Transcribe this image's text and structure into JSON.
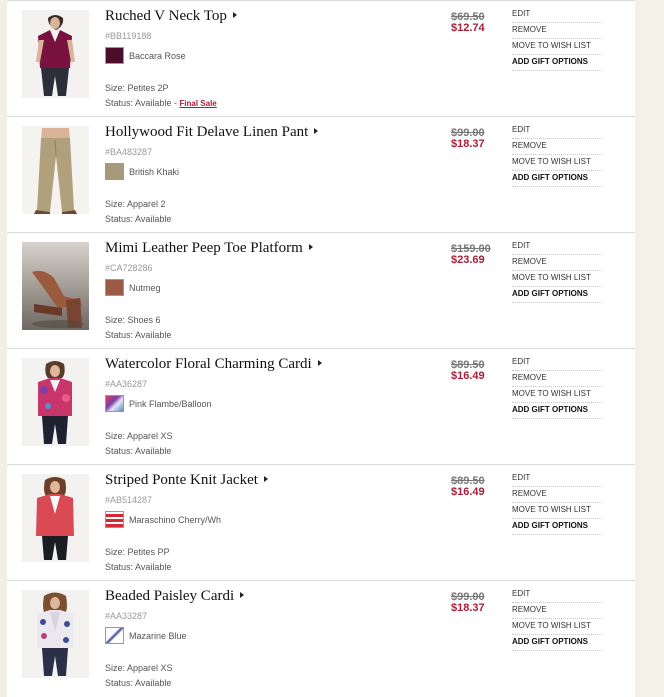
{
  "action_labels": {
    "edit": "EDIT",
    "remove": "REMOVE",
    "wishlist": "MOVE TO WISH LIST",
    "gift": "ADD GIFT OPTIONS"
  },
  "colors": {
    "sale_price": "#a6203a",
    "divider": "#dcdcdc"
  },
  "items": [
    {
      "title": "Ruched V Neck Top",
      "sku": "#BB119188",
      "color": "Baccara Rose",
      "swatch": "#4a0e2a",
      "size": "Size: Petites 2P",
      "status": "Status: Available - ",
      "final_sale": "Final Sale",
      "orig_price": "$69.50",
      "sale_price": "$12.74"
    },
    {
      "title": "Hollywood Fit Delave Linen Pant",
      "sku": "#BA483287",
      "color": "British Khaki",
      "swatch": "#a59a7c",
      "size": "Size: Apparel 2",
      "status": "Status: Available",
      "final_sale": "",
      "orig_price": "$99.00",
      "sale_price": "$18.37"
    },
    {
      "title": "Mimi Leather Peep Toe Platform",
      "sku": "#CA728286",
      "color": "Nutmeg",
      "swatch": "#9a5a43",
      "size": "Size: Shoes 6",
      "status": "Status: Available",
      "final_sale": "",
      "orig_price": "$159.00",
      "sale_price": "$23.69"
    },
    {
      "title": "Watercolor Floral Charming Cardi",
      "sku": "#AA36287",
      "color": "Pink Flambe/Balloon",
      "swatch": "#d8406a",
      "size": "Size: Apparel XS",
      "status": "Status: Available",
      "final_sale": "",
      "orig_price": "$89.50",
      "sale_price": "$16.49"
    },
    {
      "title": "Striped Ponte Knit Jacket",
      "sku": "#AB514287",
      "color": "Maraschino Cherry/Wh",
      "swatch": "#d62936",
      "size": "Size: Petites PP",
      "status": "Status: Available",
      "final_sale": "",
      "orig_price": "$89.50",
      "sale_price": "$16.49"
    },
    {
      "title": "Beaded Paisley Cardi",
      "sku": "#AA33287",
      "color": "Mazarine Blue",
      "swatch": "#3c4a94",
      "size": "Size: Apparel XS",
      "status": "Status: Available",
      "final_sale": "",
      "orig_price": "$99.00",
      "sale_price": "$18.37"
    }
  ]
}
